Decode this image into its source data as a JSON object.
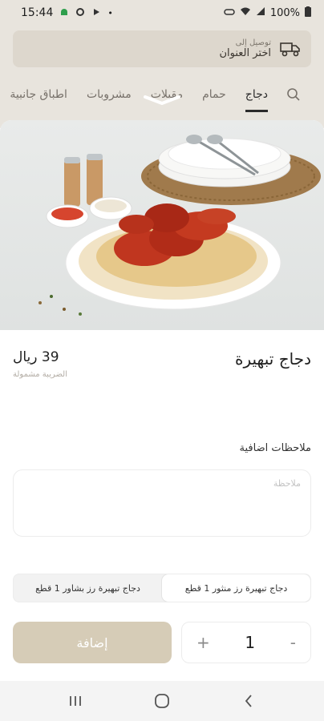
{
  "status_bar": {
    "time": "15:44",
    "battery": "100%"
  },
  "delivery": {
    "label": "توصيل إلى",
    "address_prompt": "اختر العنوان"
  },
  "categories": [
    {
      "label": "دجاج",
      "active": true
    },
    {
      "label": "حمام",
      "active": false
    },
    {
      "label": "مقبلات",
      "active": false
    },
    {
      "label": "مشروبات",
      "active": false
    },
    {
      "label": "اطباق جانبية",
      "active": false
    }
  ],
  "product": {
    "name": "دجاج تبهيرة",
    "price": "39 ريال",
    "tax_note": "الضريبة مشمولة"
  },
  "notes": {
    "label": "ملاحظات اضافية",
    "placeholder": "ملاحظة"
  },
  "options": {
    "selected": "دجاج تبهيرة رز منثور 1 قطع",
    "other": "دجاج تبهيرة رز بشاور 1 قطع"
  },
  "quantity": {
    "value": "1",
    "minus": "-",
    "plus": "+"
  },
  "add_button": "إضافة",
  "colors": {
    "accent": "#d6ccb7",
    "background_dim": "#e8e4dd"
  }
}
